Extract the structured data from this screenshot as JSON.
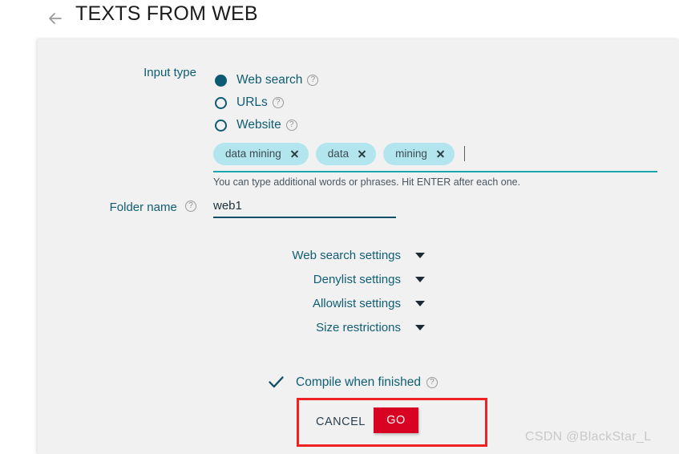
{
  "header": {
    "back_icon": "back-arrow-icon",
    "title": "TEXTS FROM WEB"
  },
  "form": {
    "input_type": {
      "label": "Input type",
      "options": [
        {
          "label": "Web search",
          "selected": true,
          "help": "?"
        },
        {
          "label": "URLs",
          "selected": false,
          "help": "?"
        },
        {
          "label": "Website",
          "selected": false,
          "help": "?"
        }
      ]
    },
    "tags": {
      "chips": [
        {
          "text": "data mining"
        },
        {
          "text": "data"
        },
        {
          "text": "mining"
        }
      ],
      "input_value": "",
      "hint": "You can type additional words or phrases. Hit ENTER after each one."
    },
    "folder_name": {
      "label": "Folder name",
      "help": "?",
      "value": "web1",
      "placeholder": "Folder name"
    },
    "settings_sections": [
      {
        "label": "Web search settings",
        "icon": "chevron-down-icon",
        "expanded": false
      },
      {
        "label": "Denylist settings",
        "icon": "chevron-down-icon",
        "expanded": false
      },
      {
        "label": "Allowlist settings",
        "icon": "chevron-down-icon",
        "expanded": false
      },
      {
        "label": "Size restrictions",
        "icon": "chevron-down-icon",
        "expanded": false
      }
    ],
    "compile": {
      "label": "Compile when finished",
      "checked": true,
      "help": "?",
      "icon": "checkmark-icon"
    },
    "actions": {
      "cancel_label": "CANCEL",
      "go_label": "GO"
    }
  },
  "annotation": {
    "shape": "red-highlight-rectangle"
  },
  "watermark": {
    "text": "CSDN @BlackStar_L"
  },
  "colors": {
    "accent_teal": "#0f5d73",
    "chip_background": "#b3e5ef",
    "tags_underline": "#1aa4ae",
    "folder_underline": "#0f4f6b",
    "go_button": "#d80222",
    "annotation_red": "#ee2222",
    "panel_background": "#f1f1f1",
    "page_background": "#ffffff"
  }
}
